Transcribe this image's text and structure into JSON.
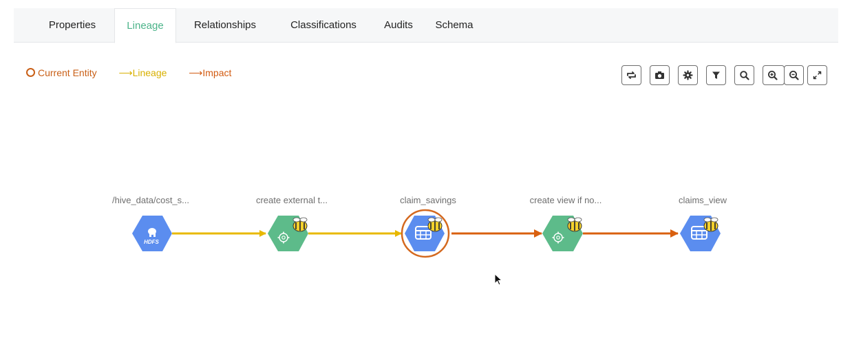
{
  "tabs": [
    {
      "label": "Properties"
    },
    {
      "label": "Lineage"
    },
    {
      "label": "Relationships"
    },
    {
      "label": "Classifications"
    },
    {
      "label": "Audits"
    },
    {
      "label": "Schema"
    }
  ],
  "active_tab": "Lineage",
  "legend": {
    "current_entity": "Current Entity",
    "lineage": "Lineage",
    "impact": "Impact"
  },
  "toolbar": {
    "buttons": [
      "refresh-icon",
      "camera-icon",
      "settings-icon",
      "filter-icon",
      "search-icon",
      "zoom-in-icon",
      "zoom-out-icon",
      "fullscreen-icon"
    ]
  },
  "graph": {
    "nodes": [
      {
        "label": "/hive_data/cost_s...",
        "type": "hdfs",
        "badge": "HDFS"
      },
      {
        "label": "create external t...",
        "type": "process"
      },
      {
        "label": "claim_savings",
        "type": "table",
        "current": true
      },
      {
        "label": "create view if no...",
        "type": "process"
      },
      {
        "label": "claims_view",
        "type": "table"
      }
    ],
    "edges": [
      {
        "from": 0,
        "to": 1,
        "kind": "lineage"
      },
      {
        "from": 1,
        "to": 2,
        "kind": "lineage"
      },
      {
        "from": 2,
        "to": 3,
        "kind": "impact"
      },
      {
        "from": 3,
        "to": 4,
        "kind": "impact"
      }
    ]
  },
  "colors": {
    "lineage": "#e8b800",
    "impact": "#d9600f",
    "current": "#d4691f",
    "table_node": "#5b8def",
    "process_node": "#5dbb8a",
    "active_tab": "#4bb389"
  }
}
